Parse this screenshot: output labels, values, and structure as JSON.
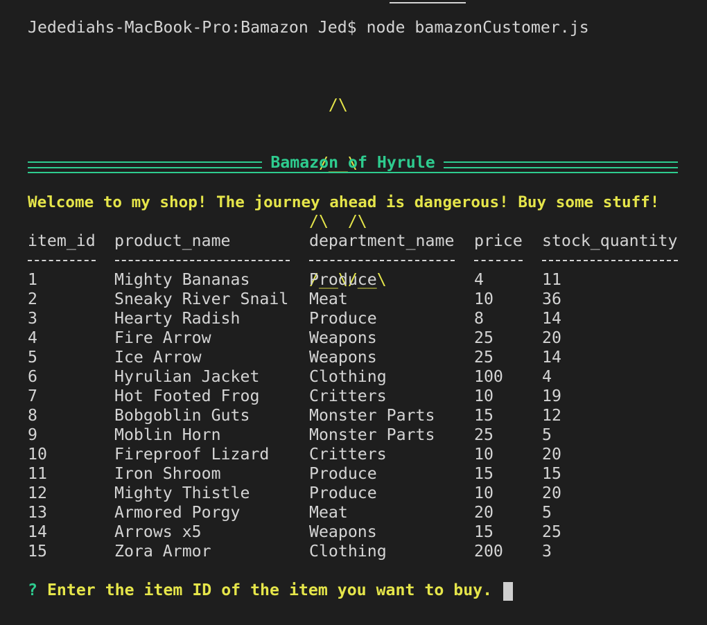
{
  "command_line": "Jedediahs-MacBook-Pro:Bamazon Jed$ node bamazonCustomer.js",
  "logo_lines": [
    "  /\\",
    " /__\\",
    "/\\  /\\",
    "/__\\/__\\"
  ],
  "banner_title": "Bamazon of Hyrule",
  "welcome": "Welcome to my shop! The journey ahead is dangerous! Buy some stuff!",
  "table": {
    "headers": [
      "item_id",
      "product_name",
      "department_name",
      "price",
      "stock_quantity"
    ],
    "rows": [
      [
        "1",
        "Mighty Bananas",
        "Produce",
        "4",
        "11"
      ],
      [
        "2",
        "Sneaky River Snail",
        "Meat",
        "10",
        "36"
      ],
      [
        "3",
        "Hearty Radish",
        "Produce",
        "8",
        "14"
      ],
      [
        "4",
        "Fire Arrow",
        "Weapons",
        "25",
        "20"
      ],
      [
        "5",
        "Ice Arrow",
        "Weapons",
        "25",
        "14"
      ],
      [
        "6",
        "Hyrulian Jacket",
        "Clothing",
        "100",
        "4"
      ],
      [
        "7",
        "Hot Footed Frog",
        "Critters",
        "10",
        "19"
      ],
      [
        "8",
        "Bobgoblin Guts",
        "Monster Parts",
        "15",
        "12"
      ],
      [
        "9",
        "Moblin Horn",
        "Monster Parts",
        "25",
        "5"
      ],
      [
        "10",
        "Fireproof Lizard",
        "Critters",
        "10",
        "20"
      ],
      [
        "11",
        "Iron Shroom",
        "Produce",
        "15",
        "15"
      ],
      [
        "12",
        "Mighty Thistle",
        "Produce",
        "10",
        "20"
      ],
      [
        "13",
        "Armored Porgy",
        "Meat",
        "20",
        "5"
      ],
      [
        "14",
        "Arrows x5",
        "Weapons",
        "15",
        "25"
      ],
      [
        "15",
        "Zora Armor",
        "Clothing",
        "200",
        "3"
      ]
    ]
  },
  "prompt": {
    "symbol": "?",
    "message": "Enter the item ID of the item you want to buy."
  },
  "colors": {
    "background": "#1e1e1e",
    "text": "#d4d4d4",
    "yellow": "#e5e54a",
    "green": "#2ecc8f"
  }
}
